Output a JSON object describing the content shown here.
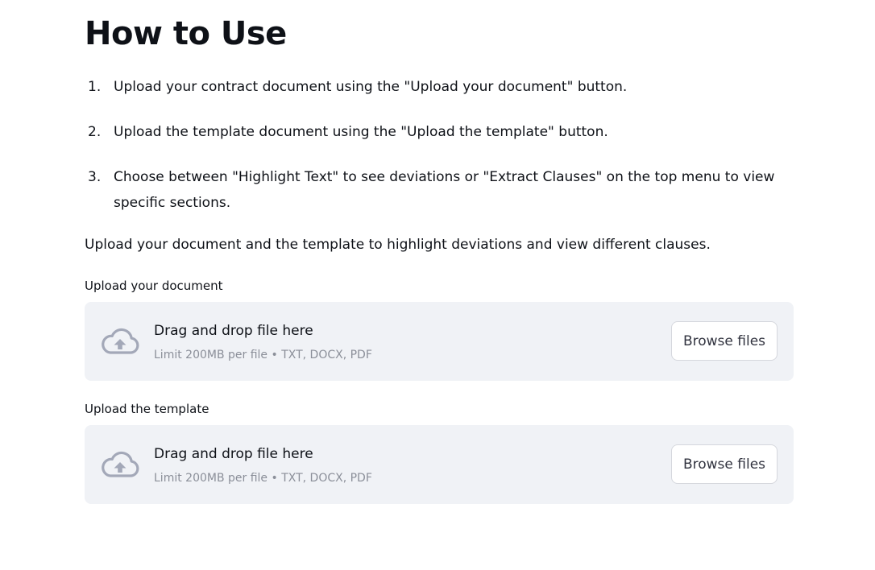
{
  "page": {
    "title": "How to Use"
  },
  "steps": [
    {
      "num": "1.",
      "text": "Upload your contract document using the \"Upload your document\" button."
    },
    {
      "num": "2.",
      "text": "Upload the template document using the \"Upload the template\" button."
    },
    {
      "num": "3.",
      "text": "Choose between \"Highlight Text\" to see deviations or \"Extract Clauses\" on the top menu to view specific sections."
    }
  ],
  "intro": "Upload your document and the template to highlight deviations and view different clauses.",
  "uploaders": [
    {
      "label": "Upload your document",
      "drop_title": "Drag and drop file here",
      "limit": "Limit 200MB per file • TXT, DOCX, PDF",
      "button": "Browse files",
      "icon": "cloud-upload-icon"
    },
    {
      "label": "Upload the template",
      "drop_title": "Drag and drop file here",
      "limit": "Limit 200MB per file • TXT, DOCX, PDF",
      "button": "Browse files",
      "icon": "cloud-upload-icon"
    }
  ],
  "colors": {
    "dropzone_bg": "#f0f2f6",
    "icon": "#a3a8b8",
    "muted_text": "#8b8f99"
  }
}
